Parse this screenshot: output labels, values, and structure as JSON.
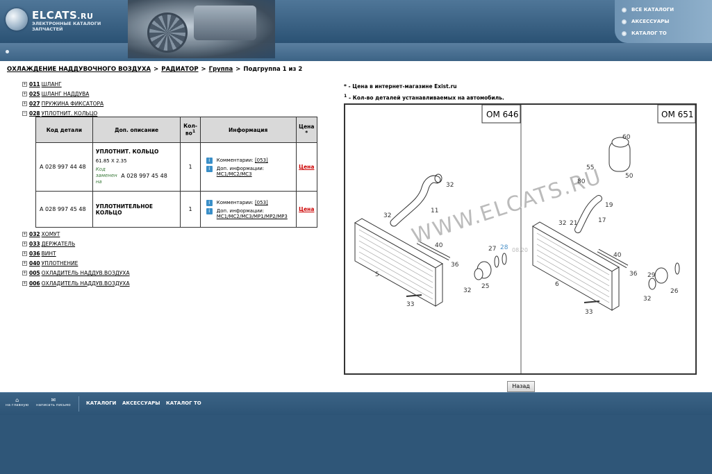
{
  "header": {
    "logo_title": "ELCATS",
    "logo_ru": ".RU",
    "logo_sub": "ЭЛЕКТРОННЫЕ КАТАЛОГИ ЗАПЧАСТЕЙ",
    "menu": [
      "ВСЕ КАТАЛОГИ",
      "АКСЕССУАРЫ",
      "КАТАЛОГ ТО"
    ]
  },
  "breadcrumb": {
    "item1": "ОХЛАЖДЕНИЕ НАДДУВОЧНОГО ВОЗДУХА",
    "item2": "РАДИАТОР",
    "item3": "Группа",
    "item4": "Подгруппа 1 из 2",
    "sep": ">"
  },
  "tree_top": [
    {
      "code": "011",
      "name": "ШЛАНГ",
      "toggle": "+"
    },
    {
      "code": "025",
      "name": "ШЛАНГ НАДДУВА",
      "toggle": "+"
    },
    {
      "code": "027",
      "name": "ПРУЖИНА ФИКСАТОРА",
      "toggle": "+"
    },
    {
      "code": "028",
      "name": "УПЛОТНИТ. КОЛЬЦО",
      "toggle": "−"
    }
  ],
  "table": {
    "headers": {
      "code": "Код детали",
      "desc": "Доп. описание",
      "qty_a": "Кол-",
      "qty_b": "во",
      "qty_sup": "1",
      "info": "Информация",
      "price_a": "Цена",
      "price_b": "*"
    },
    "rows": [
      {
        "code": "A 028 997 44 48",
        "desc_title": "УПЛОТНИТ. КОЛЬЦО",
        "desc_dims": "61.85 X 2.35",
        "replaced_note": "Код заменен на",
        "replaced_code": "A 028 997 45 48",
        "qty": "1",
        "comment_label": "Комментарии:",
        "comment_link": "[053]",
        "extra_label": "Доп. информации:",
        "extra_link": "MC1/MC2/MC3",
        "price": "Цена"
      },
      {
        "code": "A 028 997 45 48",
        "desc_title": "УПЛОТНИТЕЛЬНОЕ КОЛЬЦО",
        "qty": "1",
        "comment_label": "Комментарии:",
        "comment_link": "[053]",
        "extra_label": "Доп. информации:",
        "extra_link": "MC1/MC2/MC3/MP1/MP2/MP3",
        "price": "Цена"
      }
    ]
  },
  "tree_bottom": [
    {
      "code": "032",
      "name": "ХОМУТ"
    },
    {
      "code": "033",
      "name": "ДЕРЖАТЕЛЬ"
    },
    {
      "code": "036",
      "name": "ВИНТ"
    },
    {
      "code": "040",
      "name": "УПЛОТНЕНИЕ"
    },
    {
      "code": "005",
      "name": "ОХЛАДИТЕЛЬ НАДДУВ.ВОЗДУХА"
    },
    {
      "code": "006",
      "name": "ОХЛАДИТЕЛЬ НАДДУВ.ВОЗДУХА"
    }
  ],
  "legend": {
    "line1": "* - Цена в интернет-магазине Exist.ru",
    "line2_sup": "1",
    "line2": " - Кол-во деталей устанавливаемых на автомобиль."
  },
  "diagram": {
    "left_title": "OM 646",
    "right_title": "OM 651",
    "watermark": "WWW.ELCATS.RU",
    "stamp": "08.20",
    "left_labels": [
      "32",
      "11",
      "32",
      "40",
      "27",
      "28",
      "36",
      "5",
      "32",
      "25",
      "33"
    ],
    "right_labels": [
      "60",
      "55",
      "80",
      "50",
      "19",
      "32",
      "21",
      "17",
      "40",
      "36",
      "29",
      "6",
      "32",
      "26",
      "33"
    ]
  },
  "back_label": "Назад",
  "footer": {
    "home": "на главную",
    "mail": "написать письмо",
    "menu": [
      "КАТАЛОГИ",
      "АКСЕССУАРЫ",
      "КАТАЛОГ ТО"
    ]
  },
  "colors": {
    "header_bg": "#2b5274",
    "price_red": "#cc0000",
    "note_green": "#3a7a3a"
  }
}
